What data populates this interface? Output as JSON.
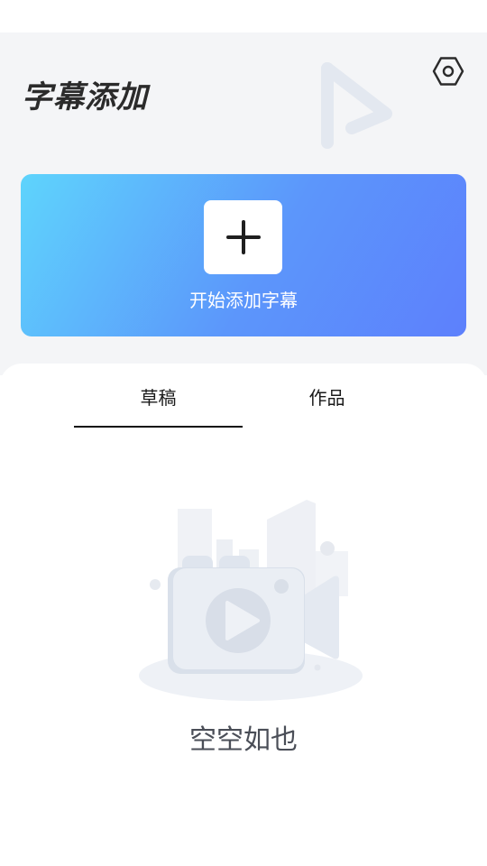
{
  "header": {
    "title": "字幕添加",
    "settings_icon": "hexagon-settings-icon",
    "decoration_icon": "play-logo-icon"
  },
  "banner": {
    "label": "开始添加字幕",
    "icon": "plus-icon",
    "gradient_start": "#5ed4fc",
    "gradient_end": "#5d80fc"
  },
  "tabs": [
    {
      "label": "草稿",
      "active": true
    },
    {
      "label": "作品",
      "active": false
    }
  ],
  "empty_state": {
    "icon": "video-camera-illustration",
    "text": "空空如也"
  }
}
